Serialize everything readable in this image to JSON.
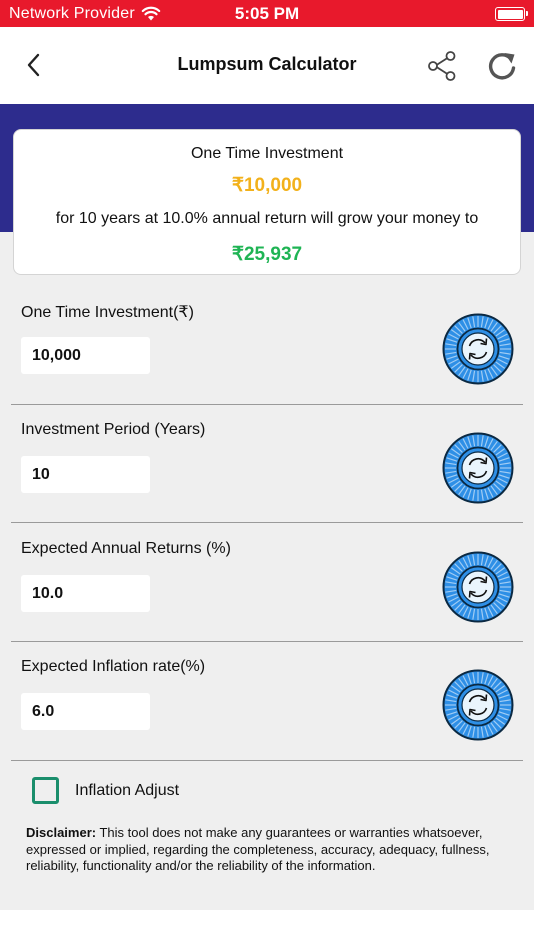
{
  "status_bar": {
    "carrier": "Network Provider",
    "time": "5:05 PM",
    "color": "#e8192c"
  },
  "nav": {
    "title": "Lumpsum Calculator",
    "back_icon": "chevron-left-icon",
    "share_icon": "share-icon",
    "refresh_icon": "refresh-icon"
  },
  "summary": {
    "label": "One Time Investment",
    "investment": "₹10,000",
    "description": "for 10 years at 10.0% annual return will grow your money to",
    "result": "₹25,937",
    "investment_color": "#f2b11b",
    "result_color": "#1fb454"
  },
  "fields": [
    {
      "label": "One Time Investment(₹)",
      "value": "10,000"
    },
    {
      "label": "Investment Period (Years)",
      "value": "10"
    },
    {
      "label": "Expected Annual Returns (%)",
      "value": "10.0"
    },
    {
      "label": "Expected Inflation rate(%)",
      "value": "6.0"
    }
  ],
  "inflation_adjust": {
    "label": "Inflation Adjust",
    "checked": false
  },
  "disclaimer": {
    "heading": "Disclaimer:",
    "text": " This tool does not make any guarantees or warranties whatsoever, expressed or implied, regarding the completeness, accuracy, adequacy, fullness, reliability, functionality and/or the reliability of the information."
  },
  "colors": {
    "header_band": "#2d2c8d",
    "dial": "#2e8fe6",
    "checkbox": "#1a8e6c"
  }
}
